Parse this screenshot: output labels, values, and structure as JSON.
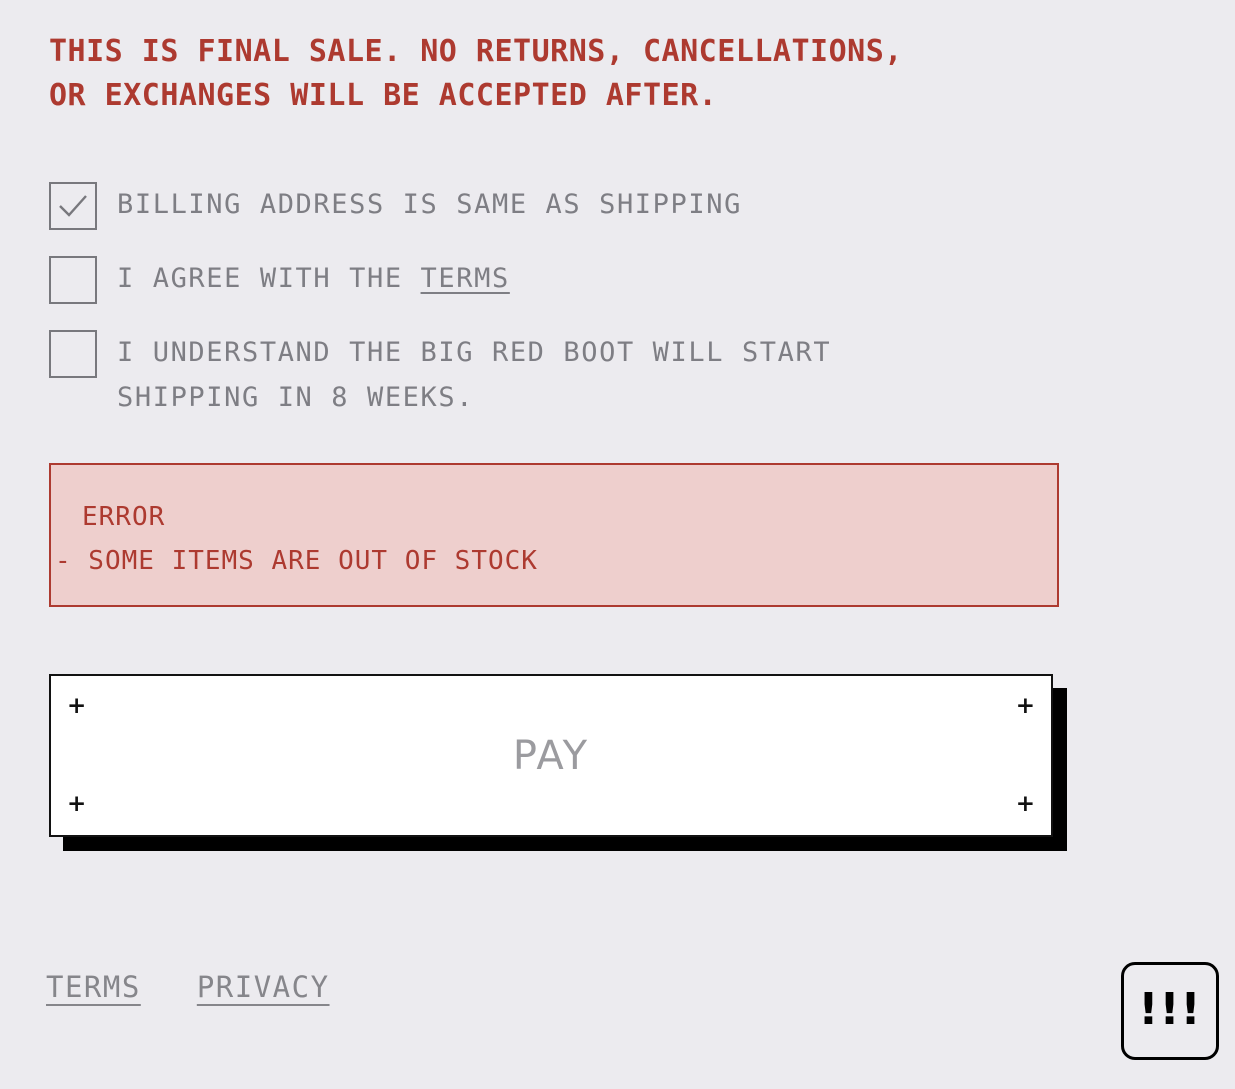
{
  "notice": {
    "text": "THIS IS FINAL SALE. NO RETURNS, CANCELLATIONS,\nOR EXCHANGES WILL BE ACCEPTED AFTER.",
    "color": "#ad3a30"
  },
  "checkboxes": [
    {
      "label": "BILLING ADDRESS IS SAME AS SHIPPING",
      "checked": true,
      "icon": "checkmark-icon"
    },
    {
      "label_before": "I AGREE WITH THE ",
      "link_text": "TERMS",
      "checked": false,
      "icon": "empty-checkbox-icon"
    },
    {
      "label": "I UNDERSTAND THE BIG RED BOOT WILL START\nSHIPPING IN 8 WEEKS.",
      "checked": false,
      "icon": "empty-checkbox-icon"
    }
  ],
  "error": {
    "title": "ERROR",
    "items": [
      "- SOME ITEMS ARE OUT OF STOCK"
    ],
    "border_color": "#ad3a30",
    "background_color": "#eecfcd"
  },
  "pay": {
    "label": "PAY",
    "corner_marks": [
      "+",
      "+",
      "+",
      "+"
    ]
  },
  "footer": {
    "links": [
      {
        "label": "TERMS"
      },
      {
        "label": "PRIVACY"
      }
    ]
  },
  "alert_badge": {
    "glyph": "!!!",
    "name": "alert-badge"
  },
  "theme": {
    "background": "#ecebef",
    "accent_red": "#ad3a30",
    "muted_text": "#7e7e84"
  }
}
